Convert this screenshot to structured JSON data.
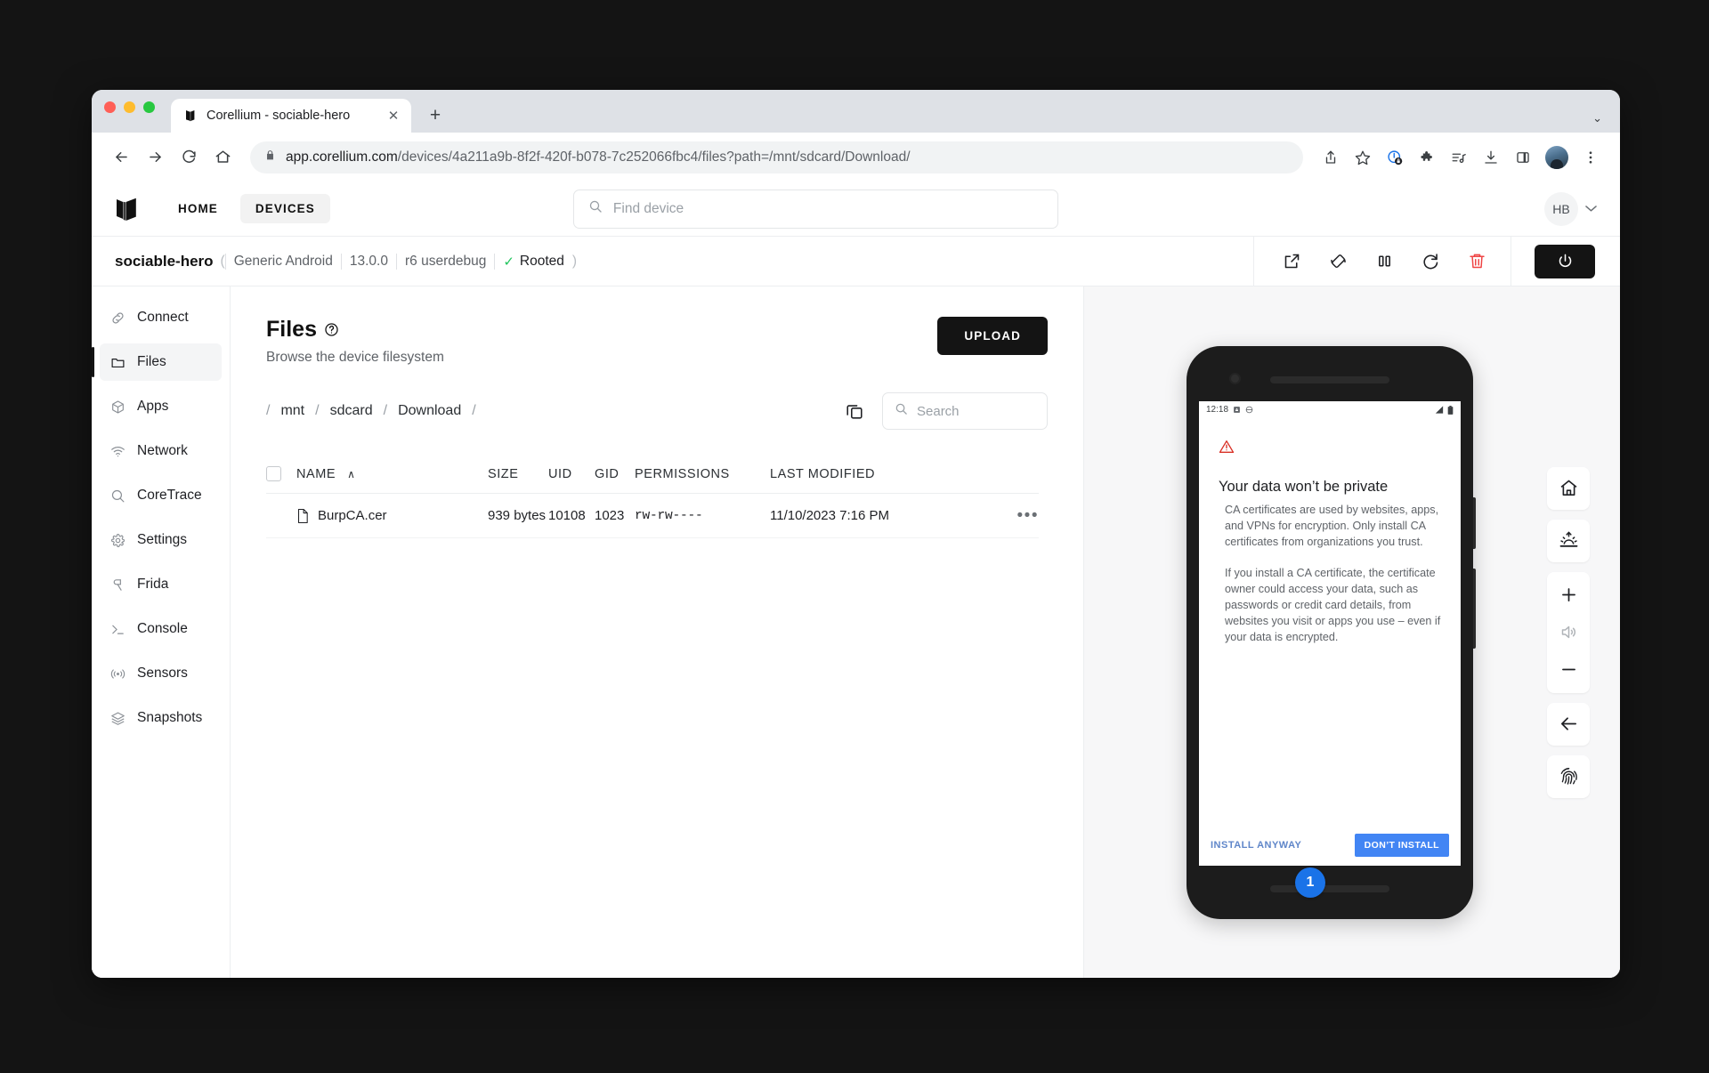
{
  "browser": {
    "tab": {
      "title": "Corellium - sociable-hero",
      "favicon_name": "corellium-favicon",
      "close_label": "✕"
    },
    "new_tab_label": "+",
    "tabstrip_menu_label": "⌄",
    "nav": {
      "back_icon": "back-arrow-icon",
      "forward_icon": "forward-arrow-icon",
      "reload_icon": "reload-icon",
      "home_icon": "home-icon"
    },
    "omnibox": {
      "lock_icon": "lock-icon",
      "url_host": "app.corellium.com",
      "url_path": "/devices/4a211a9b-8f2f-420f-b078-7c252066fbc4/files?path=/mnt/sdcard/Download/"
    },
    "toolbar_right": [
      {
        "name": "share-icon"
      },
      {
        "name": "bookmark-star-icon"
      },
      {
        "name": "privacy-lock-icon"
      },
      {
        "name": "extensions-puzzle-icon"
      },
      {
        "name": "media-playlist-icon"
      },
      {
        "name": "downloads-icon"
      },
      {
        "name": "side-panel-icon"
      },
      {
        "name": "profile-avatar"
      },
      {
        "name": "chrome-menu-icon"
      }
    ]
  },
  "app_nav": {
    "logo_name": "corellium-logo",
    "links": [
      {
        "label": "HOME",
        "active": false
      },
      {
        "label": "DEVICES",
        "active": true
      }
    ],
    "search": {
      "placeholder": "Find device",
      "value": ""
    },
    "user": {
      "initials": "HB",
      "chevron": "⌄"
    }
  },
  "device_bar": {
    "name": "sociable-hero",
    "open_paren": "(",
    "close_paren": ")",
    "os": "Generic Android",
    "version": "13.0.0",
    "build": "r6 userdebug",
    "rooted_label": "Rooted",
    "rooted_check": "✓",
    "actions": [
      {
        "name": "open-external-icon"
      },
      {
        "name": "rotate-device-icon"
      },
      {
        "name": "pause-icon"
      },
      {
        "name": "restart-icon"
      },
      {
        "name": "delete-icon"
      }
    ],
    "power": {
      "name": "power-button",
      "icon": "power-icon"
    }
  },
  "sidebar": {
    "items": [
      {
        "label": "Connect",
        "icon": "link-icon",
        "active": false
      },
      {
        "label": "Files",
        "icon": "folder-icon",
        "active": true
      },
      {
        "label": "Apps",
        "icon": "cube-icon",
        "active": false
      },
      {
        "label": "Network",
        "icon": "wifi-icon",
        "active": false
      },
      {
        "label": "CoreTrace",
        "icon": "search-icon",
        "active": false
      },
      {
        "label": "Settings",
        "icon": "gear-icon",
        "active": false
      },
      {
        "label": "Frida",
        "icon": "frida-icon",
        "active": false
      },
      {
        "label": "Console",
        "icon": "terminal-icon",
        "active": false
      },
      {
        "label": "Sensors",
        "icon": "sensors-icon",
        "active": false
      },
      {
        "label": "Snapshots",
        "icon": "layers-icon",
        "active": false
      }
    ]
  },
  "files_page": {
    "title": "Files",
    "help_icon": "help-circle-icon",
    "subtitle": "Browse the device filesystem",
    "upload_label": "UPLOAD",
    "breadcrumb": [
      "/",
      "mnt",
      "/",
      "sdcard",
      "/",
      "Download",
      "/"
    ],
    "copy_path_icon": "copy-icon",
    "search": {
      "placeholder": "Search",
      "value": ""
    },
    "columns": {
      "name": "NAME",
      "sort_arrow": "∧",
      "size": "SIZE",
      "uid": "UID",
      "gid": "GID",
      "permissions": "PERMISSIONS",
      "last_modified": "LAST MODIFIED"
    },
    "rows": [
      {
        "icon": "file-icon",
        "name": "BurpCA.cer",
        "size": "939 bytes",
        "uid": "10108",
        "gid": "1023",
        "permissions": "rw-rw----",
        "last_modified": "11/10/2023 7:16 PM",
        "menu": "•••"
      }
    ]
  },
  "device_preview": {
    "statusbar": {
      "time": "12:18",
      "left_icons": [
        "screenshot-icon",
        "sync-icon"
      ],
      "right_icons": [
        "signal-icon",
        "battery-icon"
      ]
    },
    "dialog": {
      "warning_icon": "warning-triangle-icon",
      "title": "Your data won’t be private",
      "paragraph_1": "CA certificates are used by websites, apps, and VPNs for encryption. Only install CA certificates from organizations you trust.",
      "paragraph_2": "If you install a CA certificate, the certificate owner could access your data, such as passwords or credit card details, from websites you visit or apps you use – even if your data is encrypted.",
      "install_anyway_label": "INSTALL ANYWAY",
      "dont_install_label": "DON’T INSTALL"
    },
    "step_badge": "1",
    "hw_controls": [
      {
        "name": "home-button",
        "icon": "home-icon"
      },
      {
        "name": "brightness-button",
        "icon": "brightness-icon"
      },
      {
        "name": "volume-up-button",
        "icon": "plus-icon"
      },
      {
        "name": "volume-mute-button",
        "icon": "speaker-icon"
      },
      {
        "name": "volume-down-button",
        "icon": "minus-icon"
      },
      {
        "name": "back-button",
        "icon": "back-arrow-icon"
      },
      {
        "name": "fingerprint-button",
        "icon": "fingerprint-icon"
      }
    ]
  },
  "colors": {
    "accent_dark": "#141414",
    "danger": "#ef4444",
    "rooted_green": "#22c55e",
    "android_blue": "#4285f4",
    "badge_blue": "#1a73e8",
    "warning_red": "#d93025"
  }
}
